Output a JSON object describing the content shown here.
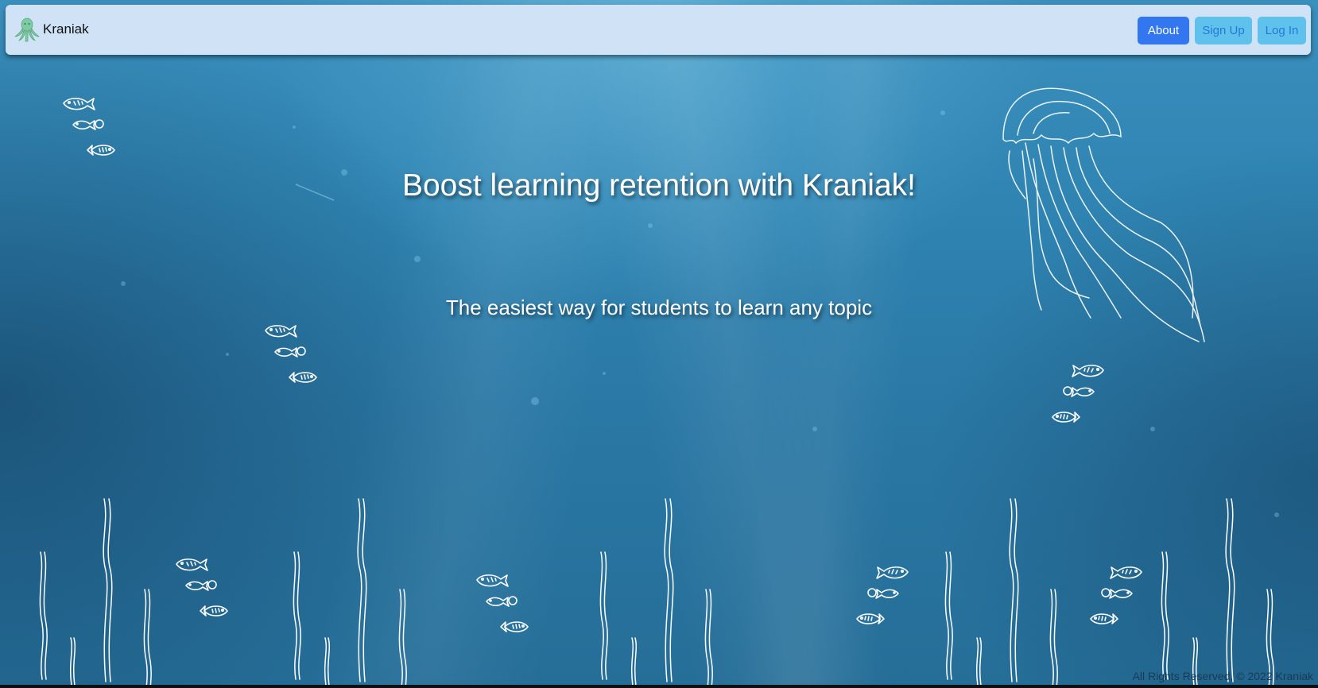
{
  "brand": {
    "name": "Kraniak",
    "logo_icon": "octopus-logo-icon"
  },
  "nav": {
    "about_label": "About",
    "signup_label": "Sign Up",
    "login_label": "Log In"
  },
  "hero": {
    "title": "Boost learning retention with Kraniak!",
    "subtitle": "The easiest way for students to learn any topic"
  },
  "footer": {
    "text": "All Rights Reserved, © 2022 Kraniak"
  },
  "decor": {
    "background": "underwater-ocean-scene",
    "icons": [
      "jellyfish-icon",
      "fish-school-icon",
      "seaweed-icon"
    ]
  },
  "colors": {
    "navbar_bg": "#d0e2f6",
    "about_btn": "#3276f0",
    "secondary_btn": "#5ec2ec",
    "secondary_btn_text": "#2778d6",
    "ocean": "#2f84b2"
  }
}
